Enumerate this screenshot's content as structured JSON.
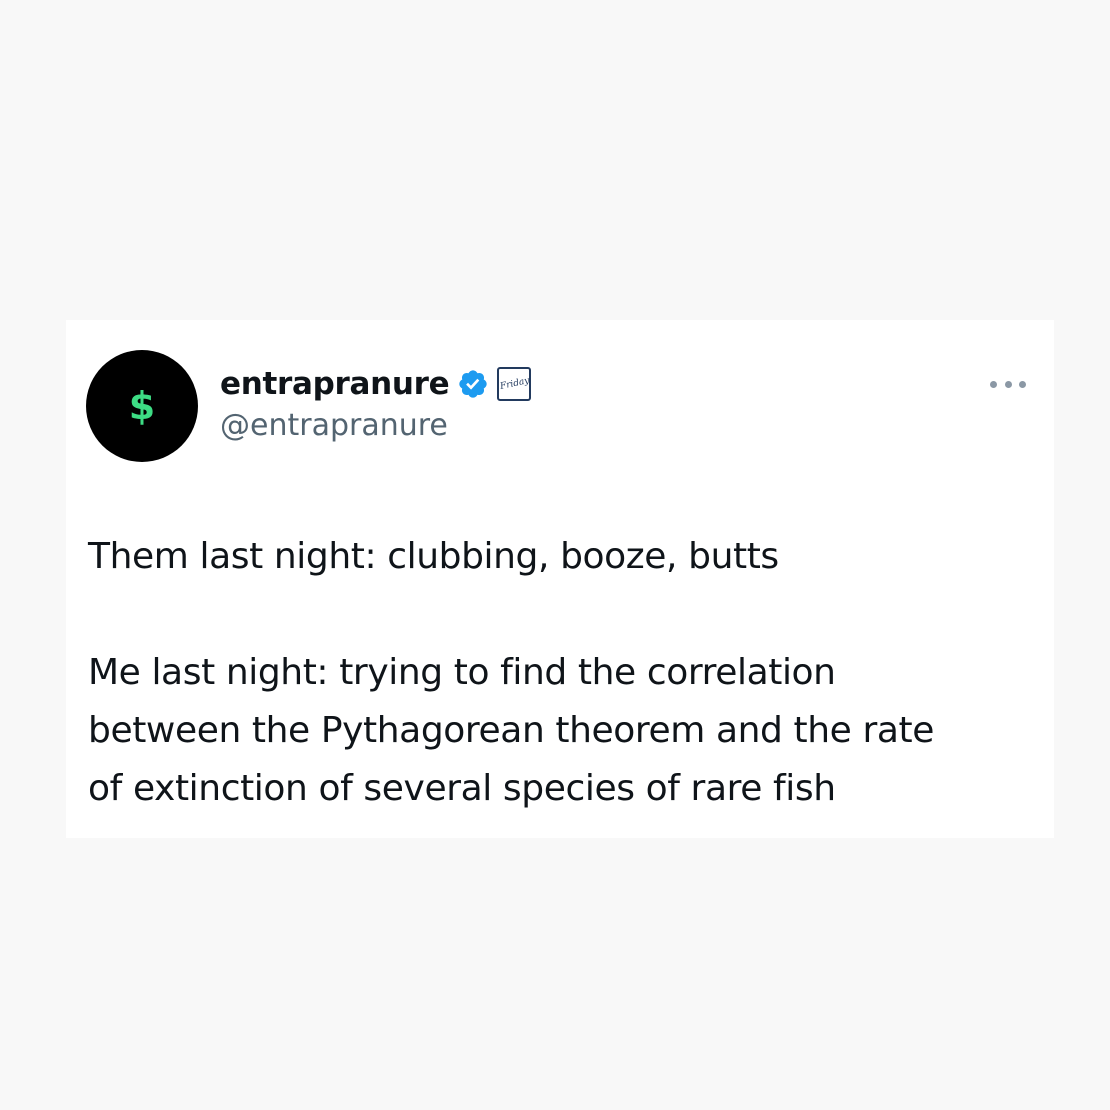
{
  "tweet": {
    "avatar": {
      "icon": "dollar-sign-icon",
      "glyph": "$",
      "background_color": "#000000",
      "glyph_color": "#3ddc84"
    },
    "author": {
      "display_name": "entrapranure",
      "handle": "@entrapranure",
      "verified": true,
      "verified_color": "#1d9bf0",
      "affiliate_badge_text": "Friday"
    },
    "more_menu": {
      "icon": "more-horizontal-icon"
    },
    "text": {
      "paragraph_1": [
        "Them last night: clubbing, booze, butts"
      ],
      "paragraph_2": [
        "Me last night: trying to find the correlation",
        "between the Pythagorean theorem and the rate",
        "of extinction of several species of rare fish"
      ]
    }
  }
}
